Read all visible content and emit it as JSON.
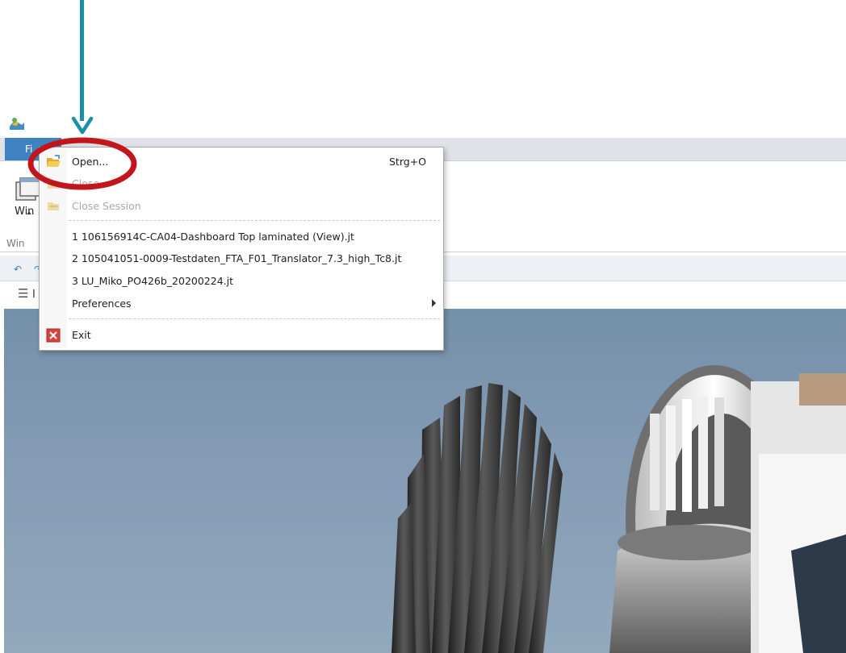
{
  "app": {
    "icon": "app-logo-icon"
  },
  "ribbon": {
    "file_tab": "Fi",
    "button_label": "Win",
    "group_label": "Win"
  },
  "qat": {
    "undo_icon": "undo-icon",
    "redo_icon": "redo-icon"
  },
  "panel": {
    "label": "I",
    "menu_icon": "hamburger-icon"
  },
  "file_menu": {
    "open": {
      "label": "Open...",
      "shortcut": "Strg+O",
      "icon": "folder-open-icon"
    },
    "close": {
      "label": "Close",
      "icon": "close-file-icon"
    },
    "close_session": {
      "label": "Close Session",
      "icon": "close-session-icon"
    },
    "recent": [
      "1 106156914C-CA04-Dashboard Top laminated (View).jt",
      "2 105041051-0009-Testdaten_FTA_F01_Translator_7.3_high_Tc8.jt",
      "3 LU_Miko_PO426b_20200224.jt"
    ],
    "preferences": {
      "label": "Preferences"
    },
    "exit": {
      "label": "Exit",
      "icon": "exit-icon"
    }
  },
  "annotation": {
    "arrow_color": "#1a90a8",
    "highlight_color": "#c0161c"
  }
}
